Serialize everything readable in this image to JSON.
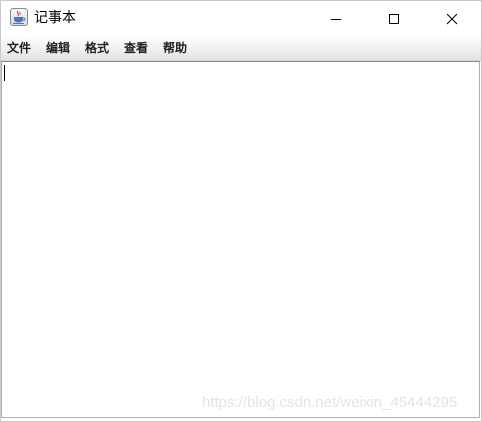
{
  "window": {
    "title": "记事本",
    "app_icon": "java-cup-icon",
    "controls": [
      "minimize-icon",
      "maximize-icon",
      "close-icon"
    ]
  },
  "menubar": {
    "items": [
      {
        "label": "文件"
      },
      {
        "label": "编辑"
      },
      {
        "label": "格式"
      },
      {
        "label": "查看"
      },
      {
        "label": "帮助"
      }
    ]
  },
  "editor": {
    "text": ""
  },
  "watermark": {
    "text": "https://blog.csdn.net/weixin_45444295"
  }
}
